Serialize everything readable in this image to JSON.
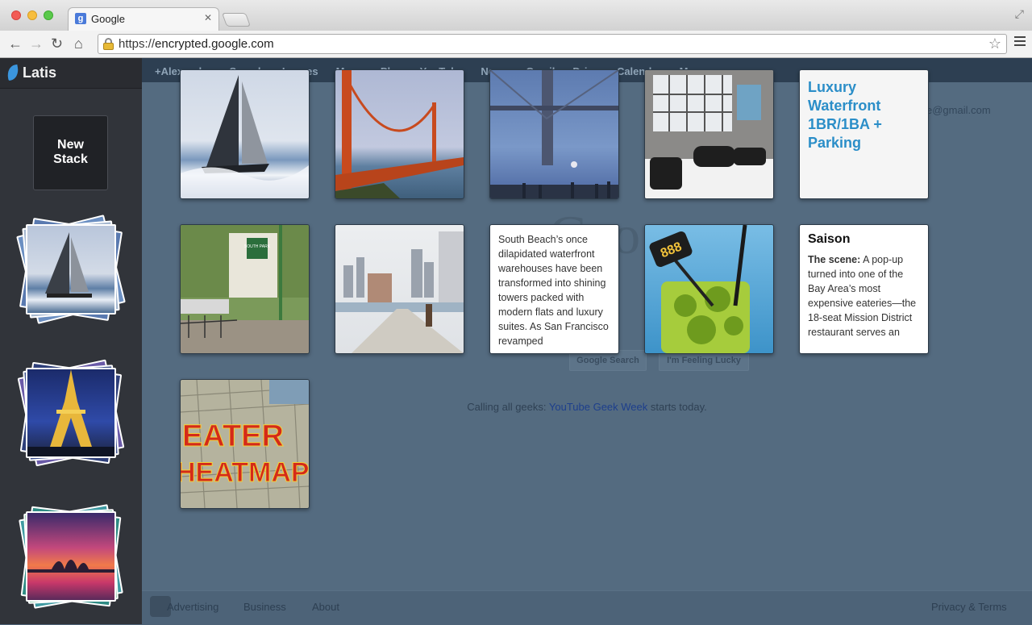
{
  "browser": {
    "tab_title": "Google",
    "tab_favicon_letter": "g",
    "url_scheme": "https://",
    "url_host": "encrypted.google.com"
  },
  "google_page": {
    "gbar_items": [
      "+Alexander",
      "Search",
      "Images",
      "Maps",
      "Play",
      "YouTube",
      "News",
      "Gmail",
      "Drive",
      "Calendar",
      "More"
    ],
    "account_email": "e@gmail.com",
    "logo_partial": "Goo       g",
    "search_button": "Google Search",
    "lucky_button": "I'm Feeling Lucky",
    "promo_text": "Calling all geeks: ",
    "promo_link": "YouTube Geek Week",
    "promo_suffix": " starts today.",
    "footer": {
      "advertising": "Advertising",
      "business": "Business",
      "about": "About",
      "privacy_terms": "Privacy & Terms"
    }
  },
  "latis": {
    "app_title": "Latis",
    "new_stack_line1": "New",
    "new_stack_line2": "Stack",
    "stacks": [
      {
        "name": "sailboat-stack",
        "icon": "sailboat-thumbnail"
      },
      {
        "name": "eiffel-stack",
        "icon": "eiffel-tower-thumbnail"
      },
      {
        "name": "sydney-stack",
        "icon": "sydney-opera-thumbnail"
      }
    ],
    "tiles": {
      "listing_title": "Luxury Waterfront 1BR/1BA + Parking",
      "south_beach_text": "South Beach’s once dilapidated waterfront warehouses have been transformed into shining towers packed with modern flats and luxury suites. As San Francisco revamped",
      "saison_heading": "Saison",
      "saison_lead": "The scene:",
      "saison_text": " A pop-up turned into one of the Bay Area’s most expensive eateries—the 18-seat Mission District restaurant serves an",
      "eater_line1": "EATER",
      "eater_line2": "HEATMAP",
      "cocktail_sign": "888",
      "park_sign": "SOUTH PARK"
    }
  },
  "colors": {
    "latis_accent": "#2b8ec8",
    "sidebar_bg": "#31343a",
    "overlay_bg": "#546b80"
  }
}
